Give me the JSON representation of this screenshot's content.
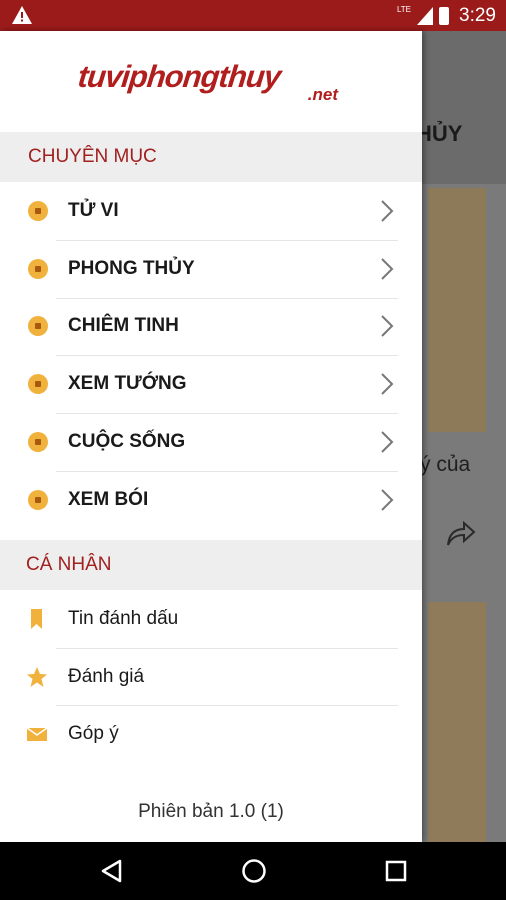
{
  "status_bar": {
    "network": "LTE",
    "time": "3:29"
  },
  "drawer": {
    "logo": {
      "main": "tuviphongthuy",
      "suffix": ".net"
    },
    "categories_header": "CHUYÊN MỤC",
    "categories": [
      {
        "label": "TỬ VI",
        "icon": "coin-icon"
      },
      {
        "label": "PHONG THỦY",
        "icon": "coin-icon"
      },
      {
        "label": "CHIÊM TINH",
        "icon": "coin-icon"
      },
      {
        "label": "XEM TƯỚNG",
        "icon": "coin-icon"
      },
      {
        "label": "CUỘC SỐNG",
        "icon": "coin-icon"
      },
      {
        "label": "XEM BÓI",
        "icon": "coin-icon"
      }
    ],
    "personal_header": "CÁ NHÂN",
    "personal": [
      {
        "label": "Tin đánh dấu",
        "icon": "bookmark-icon"
      },
      {
        "label": "Đánh giá",
        "icon": "star-icon"
      },
      {
        "label": "Góp ý",
        "icon": "mail-icon"
      }
    ],
    "version": "Phiên bản 1.0 (1)"
  },
  "background": {
    "toolbar_title_partial": "HỦY",
    "card_text_partial": "ý của"
  },
  "colors": {
    "brand": "#9b1b1b",
    "accent_gold": "#f0b23c",
    "section_text": "#a12020"
  }
}
